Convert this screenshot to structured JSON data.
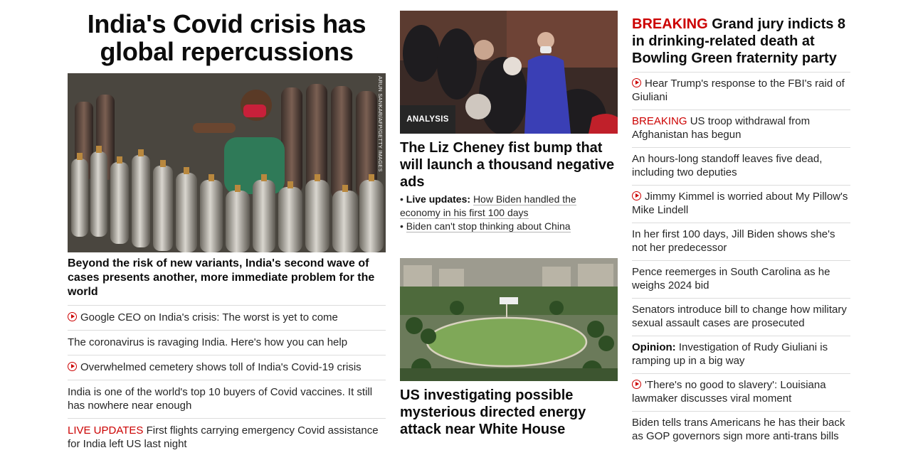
{
  "col1": {
    "headline": "India's Covid crisis has global repercussions",
    "photo_credit": "ARUN SANKAR/AFP/GETTY IMAGES",
    "summary": "Beyond the risk of new variants, India's second wave of cases presents another, more immediate problem for the world",
    "items": [
      {
        "icon": "play-icon",
        "prefix": "",
        "text": "Google CEO on India's crisis: The worst is yet to come"
      },
      {
        "icon": "",
        "prefix": "",
        "text": "The coronavirus is ravaging India. Here's how you can help"
      },
      {
        "icon": "play-icon",
        "prefix": "",
        "text": "Overwhelmed cemetery shows toll of India's Covid-19 crisis"
      },
      {
        "icon": "",
        "prefix": "",
        "text": "India is one of the world's top 10 buyers of Covid vaccines. It still has nowhere near enough"
      },
      {
        "icon": "",
        "prefix": "LIVE UPDATES",
        "text": "First flights carrying emergency Covid assistance for India left US last night"
      }
    ]
  },
  "col2": {
    "badge": "ANALYSIS",
    "headline": "The Liz Cheney fist bump that will launch a thousand negative ads",
    "sub1_bold": "Live updates:",
    "sub1_text": "How Biden handled the economy in his first 100 days",
    "sub2_text": "Biden can't stop thinking about China",
    "headline2": "US investigating possible mysterious directed energy attack near White House"
  },
  "col3": {
    "lead_prefix": "BREAKING",
    "lead_text": "Grand jury indicts 8 in drinking-related death at Bowling Green fraternity party",
    "items": [
      {
        "icon": "play-icon",
        "prefix": "",
        "text": "Hear Trump's response to the FBI's raid of Giuliani"
      },
      {
        "icon": "",
        "prefix": "BREAKING",
        "text": "US troop withdrawal from Afghanistan has begun"
      },
      {
        "icon": "",
        "prefix": "",
        "text": "An hours-long standoff leaves five dead, including two deputies"
      },
      {
        "icon": "play-icon",
        "prefix": "",
        "text": "Jimmy Kimmel is worried about My Pillow's Mike Lindell"
      },
      {
        "icon": "",
        "prefix": "",
        "text": "In her first 100 days, Jill Biden shows she's not her predecessor"
      },
      {
        "icon": "",
        "prefix": "",
        "text": "Pence reemerges in South Carolina as he weighs 2024 bid"
      },
      {
        "icon": "",
        "prefix": "",
        "text": "Senators introduce bill to change how military sexual assault cases are prosecuted"
      },
      {
        "icon": "",
        "prefix": "Opinion:",
        "text": "Investigation of Rudy Giuliani is ramping up in a big way"
      },
      {
        "icon": "play-icon",
        "prefix": "",
        "text": "'There's no good to slavery': Louisiana lawmaker discusses viral moment"
      },
      {
        "icon": "",
        "prefix": "",
        "text": "Biden tells trans Americans he has their back as GOP governors sign more anti-trans bills"
      }
    ]
  },
  "colors": {
    "accent_red": "#cc0000",
    "text": "#262626",
    "divider": "#dcdcdc",
    "badge_bg": "#262626"
  }
}
